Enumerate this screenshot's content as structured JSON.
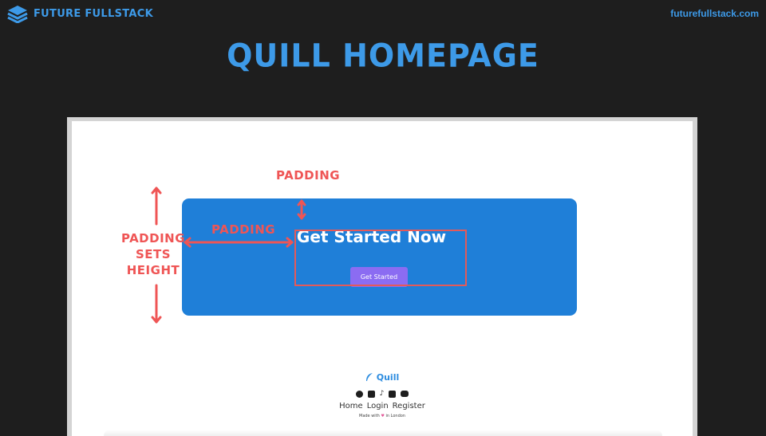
{
  "brand": {
    "name": "FUTURE FULLSTACK",
    "url": "futurefullstack.com"
  },
  "slide": {
    "title": "QUILL HOMEPAGE"
  },
  "annotations": {
    "padding_top": "PADDING",
    "padding_left": "PADDING",
    "padding_height": [
      "PADDING",
      "SETS",
      "HEIGHT"
    ]
  },
  "hero": {
    "heading": "Get Started Now",
    "button_label": "Get Started"
  },
  "footer": {
    "logo_text": "Quill",
    "social_icons": [
      "facebook-icon",
      "instagram-icon",
      "tiktok-icon",
      "linkedin-icon",
      "youtube-icon"
    ],
    "links": [
      "Home",
      "Login",
      "Register"
    ],
    "made_with": [
      "Made with",
      "in London"
    ]
  },
  "colors": {
    "background": "#1e1e1e",
    "brand_blue": "#3d9ae8",
    "hero_blue": "#1f7fd8",
    "button_purple": "#8b6cf2",
    "annotation_red": "#ef5555"
  }
}
